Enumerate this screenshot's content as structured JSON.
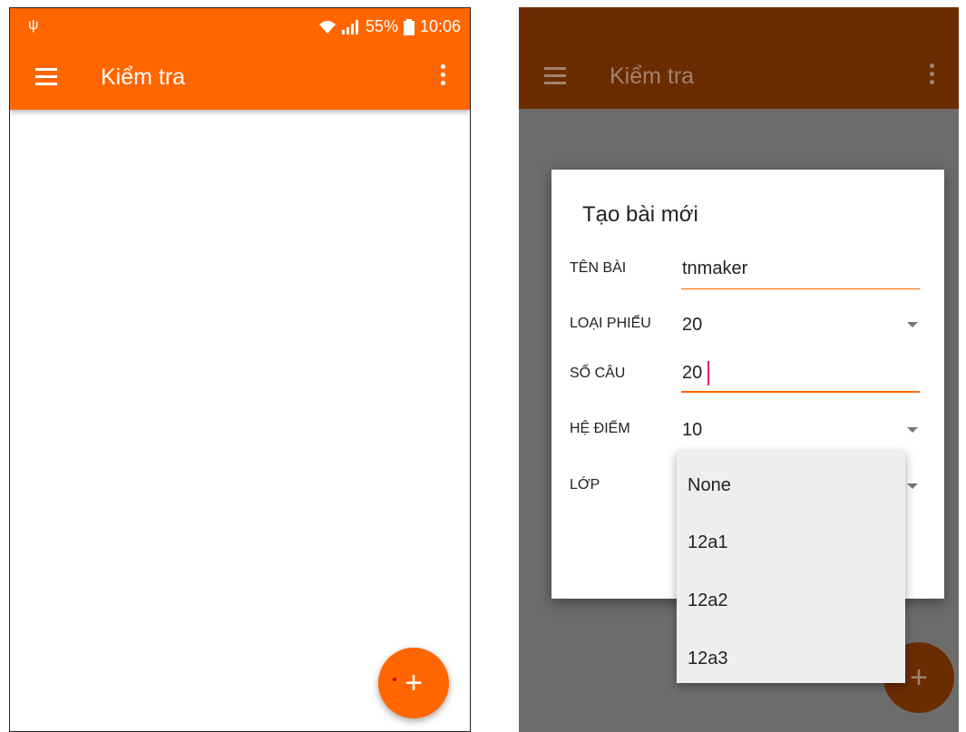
{
  "status": {
    "battery": "55%",
    "time": "10:06"
  },
  "app": {
    "title": "Kiểm tra"
  },
  "dialog": {
    "title": "Tạo bài mới",
    "fields": [
      {
        "label": "TÊN BÀI",
        "value": "tnmaker"
      },
      {
        "label": "LOẠI PHIẾU",
        "value": "20"
      },
      {
        "label": "SỐ CÂU",
        "value": "20"
      },
      {
        "label": "HỆ ĐIỂM",
        "value": "10"
      },
      {
        "label": "LỚP",
        "value": ""
      }
    ]
  },
  "dropdown": {
    "options": [
      "None",
      "12a1",
      "12a2",
      "12a3"
    ]
  },
  "icons": {
    "fab": "+"
  },
  "colors": {
    "accent": "#ff6600",
    "accent_dim": "#6b2c00",
    "caret": "#e91e63"
  }
}
